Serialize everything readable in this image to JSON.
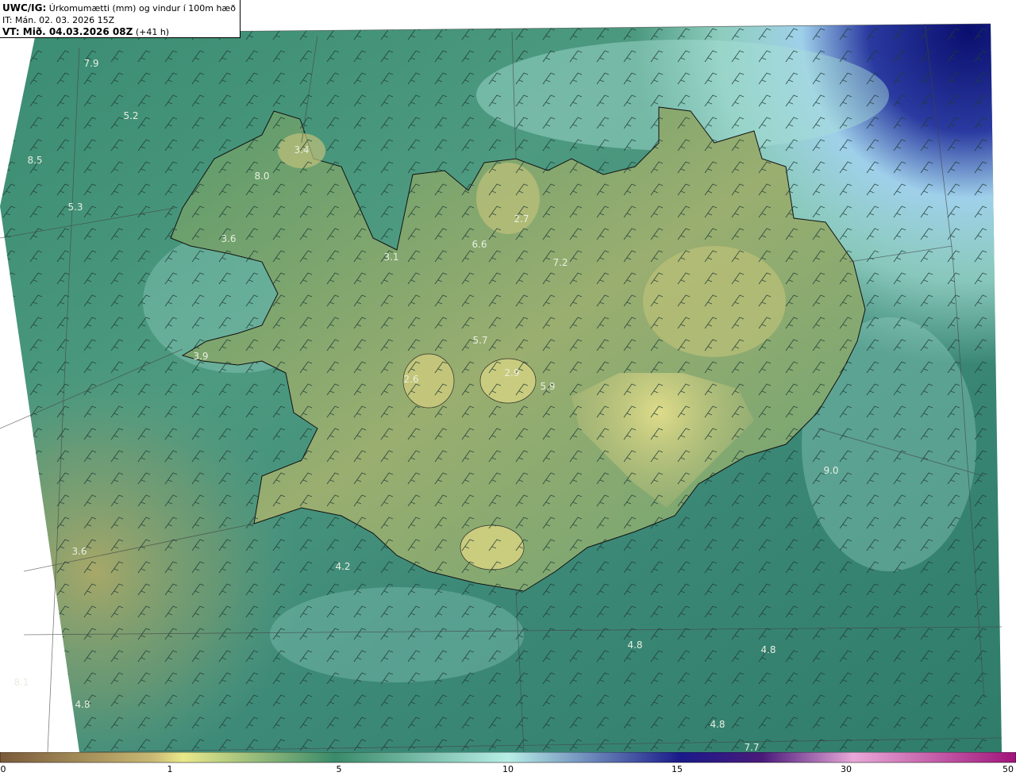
{
  "header": {
    "model": "UWC/IG:",
    "title": "Úrkomumætti (mm) og vindur í 100m hæð",
    "initial_time": "IT: Mán. 02. 03. 2026 15Z",
    "valid_prefix": "VT: Mið. 04.03.2026 08Z",
    "valid_offset": "(+41 h)"
  },
  "map_values": [
    "7.9",
    "5.2",
    "8.5",
    "3.4",
    "8.0",
    "5.3",
    "3.6",
    "2.7",
    "6.6",
    "3.1",
    "7.2",
    "5.7",
    "3.9",
    "2.6",
    "2.9",
    "5.9",
    "9.0",
    "3.6",
    "4.2",
    "8.1",
    "4.8",
    "4.8",
    "4.8",
    "4.8",
    "7.7"
  ],
  "colorbar": {
    "ticks": [
      "0",
      "1",
      "5",
      "10",
      "15",
      "30",
      "50"
    ],
    "colors": [
      "#7a5a3a",
      "#c8b874",
      "#eae88a",
      "#3a8a6a",
      "#b8eee6",
      "#1a1a8a",
      "#4a1a7a",
      "#e8a8d8",
      "#a0147a"
    ]
  },
  "colors": {
    "land_high": "#cfd080",
    "land_mid": "#6aa070",
    "sea_low": "#3e8c7a",
    "sea_light": "#a8dcd4",
    "deep_blue": "#0a1a7a"
  }
}
